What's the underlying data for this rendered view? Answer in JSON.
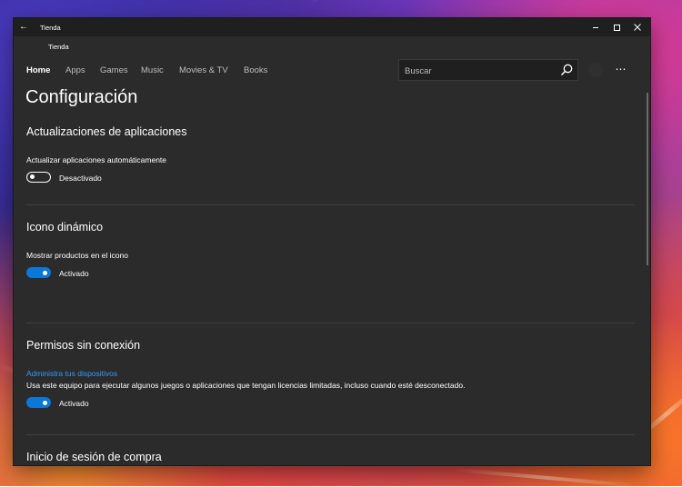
{
  "window": {
    "title": "Tienda",
    "subtitle": "Tienda"
  },
  "nav": {
    "items": [
      {
        "label": "Home",
        "active": true
      },
      {
        "label": "Apps",
        "active": false
      },
      {
        "label": "Games",
        "active": false
      },
      {
        "label": "Music",
        "active": false
      },
      {
        "label": "Movies & TV",
        "active": false
      },
      {
        "label": "Books",
        "active": false
      }
    ]
  },
  "search": {
    "placeholder": "Buscar"
  },
  "page": {
    "title": "Configuración"
  },
  "sections": {
    "app_updates": {
      "title": "Actualizaciones de aplicaciones",
      "setting_label": "Actualizar aplicaciones automáticamente",
      "toggle_state": "Desactivado",
      "toggle_on": false
    },
    "live_tile": {
      "title": "Icono dinámico",
      "setting_label": "Mostrar productos en el icono",
      "toggle_state": "Activado",
      "toggle_on": true
    },
    "offline_permissions": {
      "title": "Permisos sin conexión",
      "link": "Administra tus dispositivos",
      "description": "Usa este equipo para ejecutar algunos juegos o aplicaciones que tengan licencias limitadas, incluso cuando esté desconectado.",
      "toggle_state": "Activado",
      "toggle_on": true
    },
    "purchase_signin": {
      "title": "Inicio de sesión de compra"
    }
  },
  "colors": {
    "accent": "#0a78d7",
    "link": "#2e9dff",
    "window_bg": "#2b2b2b",
    "titlebar_bg": "#1f1f1f"
  },
  "icons": {
    "back": "back-arrow-icon",
    "minimize": "minimize-icon",
    "maximize": "maximize-icon",
    "close": "close-icon",
    "search": "search-icon",
    "more": "more-icon",
    "account": "account-icon"
  }
}
